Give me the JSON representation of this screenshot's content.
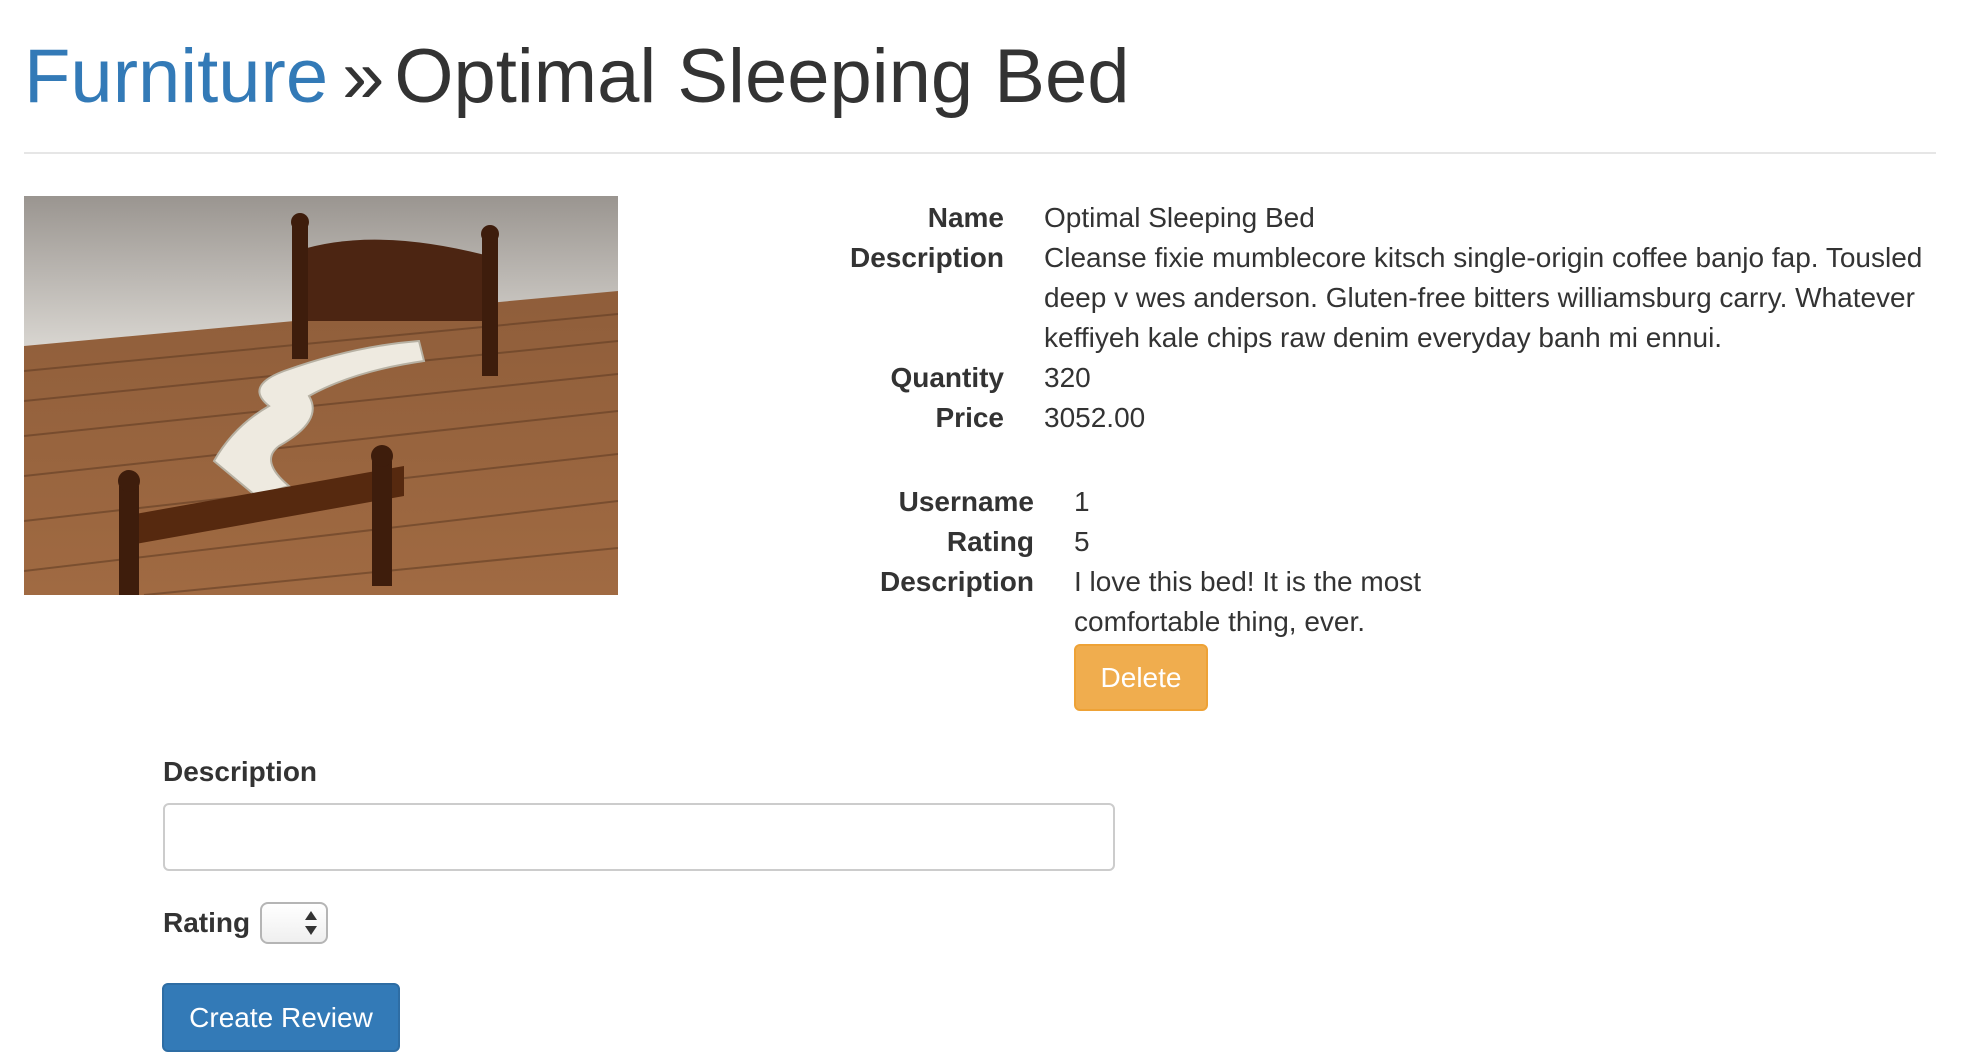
{
  "header": {
    "category_link": "Furniture",
    "separator": "»",
    "product_name": "Optimal Sleeping Bed"
  },
  "product": {
    "fields": [
      {
        "label": "Name",
        "value": "Optimal Sleeping Bed"
      },
      {
        "label": "Description",
        "value": "Cleanse fixie mumblecore kitsch single-origin coffee banjo fap. Tousled deep v wes anderson. Gluten-free bitters williamsburg carry. Whatever keffiyeh kale chips raw denim everyday banh mi ennui."
      },
      {
        "label": "Quantity",
        "value": "320"
      },
      {
        "label": "Price",
        "value": "3052.00"
      }
    ]
  },
  "review": {
    "fields": [
      {
        "label": "Username",
        "value": "1"
      },
      {
        "label": "Rating",
        "value": "5"
      },
      {
        "label": "Description",
        "value": "I love this bed! It is the most comfortable thing, ever."
      }
    ],
    "delete_label": "Delete"
  },
  "form": {
    "description_label": "Description",
    "description_value": "",
    "rating_label": "Rating",
    "rating_value": "",
    "submit_label": "Create Review"
  }
}
